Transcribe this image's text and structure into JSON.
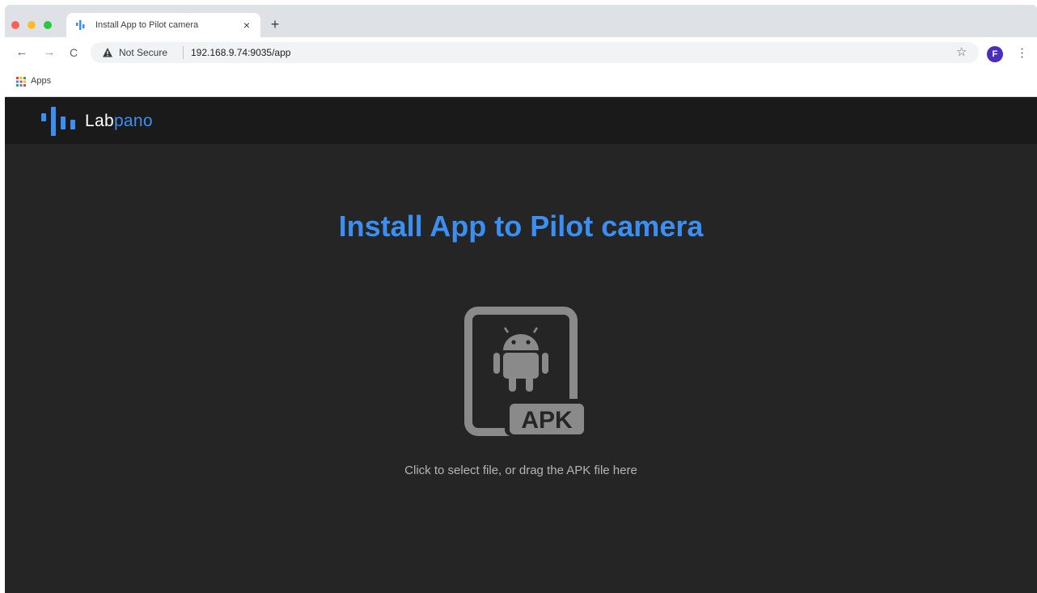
{
  "browser": {
    "tab": {
      "title": "Install App to Pilot camera",
      "close_glyph": "×"
    },
    "new_tab_glyph": "+",
    "nav": {
      "back_glyph": "←",
      "forward_glyph": "→",
      "reload_glyph": "C"
    },
    "omnibox": {
      "security_label": "Not Secure",
      "url": "192.168.9.74:9035/app",
      "star_glyph": "☆"
    },
    "profile": {
      "initial": "F",
      "color": "#4a2fbd"
    },
    "menu_glyph": "⋮",
    "bookmarks": {
      "apps_label": "Apps"
    }
  },
  "site": {
    "logo": {
      "text_part1": "Lab",
      "text_part2": "pano",
      "color": "#3b8ff2"
    },
    "title": "Install App to Pilot camera",
    "upload": {
      "icon": "android-apk-file-icon",
      "badge": "APK",
      "hint": "Click to select file, or drag the APK file here"
    },
    "colors": {
      "accent": "#3b8ff2",
      "background": "#252525",
      "header_bg": "#1a1a1a",
      "icon_gray": "#8a8a8a"
    }
  }
}
